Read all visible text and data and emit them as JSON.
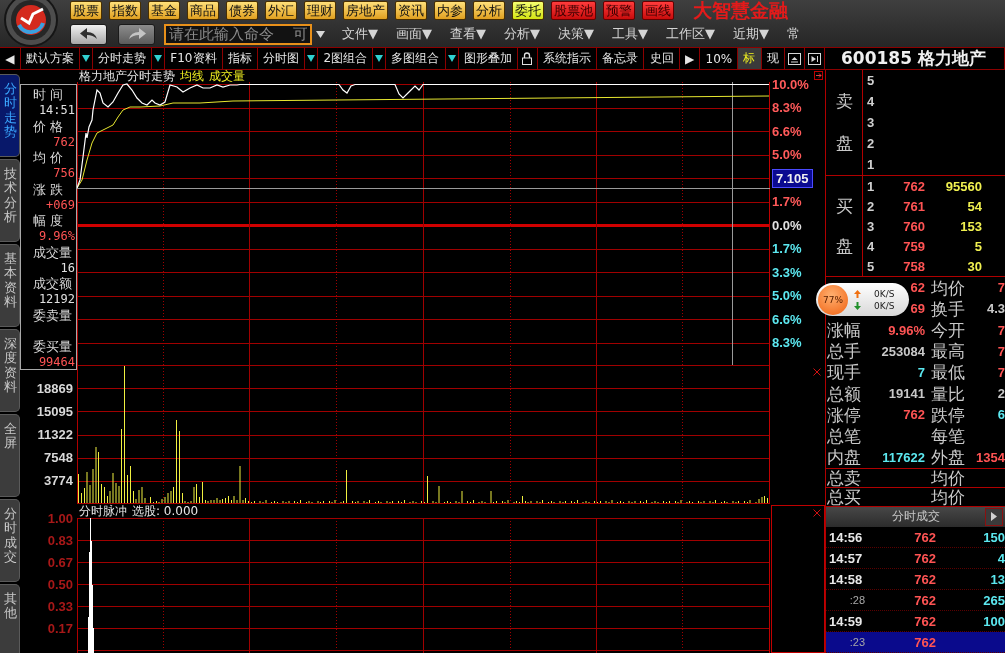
{
  "header": {
    "nav_buttons": [
      {
        "label": "股票",
        "kind": "market"
      },
      {
        "label": "指数",
        "kind": "market"
      },
      {
        "label": "基金",
        "kind": "market"
      },
      {
        "label": "商品",
        "kind": "market"
      },
      {
        "label": "债券",
        "kind": "market"
      },
      {
        "label": "外汇",
        "kind": "market"
      },
      {
        "label": "理财",
        "kind": "market"
      },
      {
        "label": "房地产",
        "kind": "market"
      },
      {
        "label": "资讯",
        "kind": "market"
      },
      {
        "label": "内参",
        "kind": "market"
      },
      {
        "label": "分析",
        "kind": "market"
      },
      {
        "label": "委托",
        "kind": "trade"
      },
      {
        "label": "股票池",
        "kind": "alert"
      },
      {
        "label": "预警",
        "kind": "alert"
      },
      {
        "label": "画线",
        "kind": "alert"
      }
    ],
    "title": "大智慧金融",
    "history": {
      "back_disabled": false,
      "forward_disabled": true
    },
    "command": {
      "placeholder": "请在此输入命令    可"
    },
    "menus": [
      "文件▼",
      "画面▼",
      "查看▼",
      "分析▼",
      "决策▼",
      "工具▼",
      "工作区▼",
      "近期▼",
      "常"
    ]
  },
  "toolbar": {
    "left_items": [
      {
        "label": "◀",
        "dropdown": false,
        "selected": false
      },
      {
        "label": "默认方案",
        "dropdown": true,
        "selected": false
      },
      {
        "label": "分时走势",
        "dropdown": true,
        "selected": false
      },
      {
        "label": "F10资料",
        "dropdown": false,
        "selected": false
      },
      {
        "label": "指标",
        "dropdown": false,
        "selected": false
      },
      {
        "label": "分时图",
        "dropdown": true,
        "selected": false
      },
      {
        "label": "2图组合",
        "dropdown": true,
        "selected": false
      },
      {
        "label": "多图组合",
        "dropdown": true,
        "selected": false
      },
      {
        "label": "图形叠加",
        "dropdown": false,
        "selected": false
      }
    ],
    "right_items": [
      {
        "label": "系统指示",
        "selected": false
      },
      {
        "label": "备忘录",
        "selected": false
      },
      {
        "label": "史回",
        "selected": false
      },
      {
        "label": "▶",
        "selected": false
      },
      {
        "label": "10%",
        "selected": false
      },
      {
        "label": "标",
        "selected": true
      },
      {
        "label": "现",
        "selected": false
      }
    ],
    "stock": "600185 格力地产"
  },
  "side_tabs": [
    {
      "label": "分时走势",
      "selected": true
    },
    {
      "label": "技术分析",
      "selected": false
    },
    {
      "label": "基本资料",
      "selected": false
    },
    {
      "label": "深度资料",
      "selected": false
    },
    {
      "label": "全屏",
      "selected": false
    },
    {
      "label": "分时成交",
      "selected": false
    },
    {
      "label": "其他",
      "selected": false
    }
  ],
  "price_chart": {
    "title": "格力地产分时走势",
    "legend": [
      "均线",
      "成交量"
    ],
    "info": [
      {
        "label": "时 间",
        "value": "14:51",
        "color": "#e0e0e0"
      },
      {
        "label": "价 格",
        "value": "762",
        "color": "#ff5454"
      },
      {
        "label": "均 价",
        "value": "756",
        "color": "#ff5454"
      },
      {
        "label": "涨 跌",
        "value": "+069",
        "color": "#ff5454"
      },
      {
        "label": "幅 度",
        "value": "9.96%",
        "color": "#ff5454"
      },
      {
        "label": "成交量",
        "value": "16",
        "color": "#e0e0e0"
      },
      {
        "label": "成交额",
        "value": "12192",
        "color": "#e0e0e0"
      },
      {
        "label": "委卖量"
      },
      {
        "label": "委买量",
        "value": "99464",
        "color": "#ff5454"
      }
    ],
    "right_axis": [
      {
        "label": "10.0%",
        "kind": "up"
      },
      {
        "label": "8.3%",
        "kind": "up"
      },
      {
        "label": "6.6%",
        "kind": "up"
      },
      {
        "label": "5.0%",
        "kind": "up"
      },
      {
        "label": "7.105",
        "kind": "cursor"
      },
      {
        "label": "1.7%",
        "kind": "up"
      },
      {
        "label": "0.0%",
        "kind": "zero"
      },
      {
        "label": "1.7%",
        "kind": "down"
      },
      {
        "label": "3.3%",
        "kind": "down"
      },
      {
        "label": "5.0%",
        "kind": "down"
      },
      {
        "label": "6.6%",
        "kind": "down"
      },
      {
        "label": "8.3%",
        "kind": "down"
      }
    ]
  },
  "volume_chart": {
    "axis": [
      "18869",
      "15095",
      "11322",
      "7548",
      "3774"
    ]
  },
  "indicator": {
    "title": "分时脉冲",
    "value": "选股: 0.000",
    "axis": [
      "1.00",
      "0.83",
      "0.67",
      "0.50",
      "0.33",
      "0.17"
    ]
  },
  "order_book": {
    "sell_label": [
      "卖",
      "盘"
    ],
    "sell": [
      {
        "rank": "5"
      },
      {
        "rank": "4"
      },
      {
        "rank": "3"
      },
      {
        "rank": "2"
      },
      {
        "rank": "1"
      }
    ],
    "buy_label": [
      "买",
      "盘"
    ],
    "buy": [
      {
        "rank": "1",
        "price": "762",
        "volume": "95560"
      },
      {
        "rank": "2",
        "price": "761",
        "volume": "54"
      },
      {
        "rank": "3",
        "price": "760",
        "volume": "153"
      },
      {
        "rank": "4",
        "price": "759",
        "volume": "5"
      },
      {
        "rank": "5",
        "price": "758",
        "volume": "30"
      }
    ]
  },
  "quote": {
    "rows": [
      {
        "cells": [
          {
            "value": "62",
            "color": "#ff5454"
          },
          {
            "label": "均价",
            "value": "7",
            "color": "#ff5454"
          }
        ]
      },
      {
        "cells": [
          {
            "value": "69",
            "color": "#ff5454"
          },
          {
            "label": "换手",
            "value": "4.3",
            "color": "#c8c8c8"
          }
        ]
      },
      {
        "cells": [
          {
            "label": "涨幅",
            "value": "9.96%",
            "color": "#ff5454"
          },
          {
            "label": "今开",
            "value": "7",
            "color": "#ff5454"
          }
        ]
      },
      {
        "cells": [
          {
            "label": "总手",
            "value": "253084",
            "color": "#c8c8c8"
          },
          {
            "label": "最高",
            "value": "7",
            "color": "#ff5454"
          }
        ]
      },
      {
        "cells": [
          {
            "label": "现手",
            "value": "7",
            "color": "#5ce8f0"
          },
          {
            "label": "最低",
            "value": "7",
            "color": "#ff5454"
          }
        ]
      },
      {
        "cells": [
          {
            "label": "总额",
            "value": "19141",
            "color": "#c8c8c8"
          },
          {
            "label": "量比",
            "value": "2",
            "color": "#c8c8c8"
          }
        ]
      },
      {
        "cells": [
          {
            "label": "涨停",
            "value": "762",
            "color": "#ff5454"
          },
          {
            "label": "跌停",
            "value": "6",
            "color": "#5ce8f0"
          }
        ]
      },
      {
        "cells": [
          {
            "label": "总笔"
          },
          {
            "label": "每笔"
          }
        ]
      },
      {
        "cells": [
          {
            "label": "内盘",
            "value": "117622",
            "color": "#5ce8f0"
          },
          {
            "label": "外盘",
            "value": "1354",
            "color": "#ff5454"
          }
        ]
      }
    ],
    "totals": [
      {
        "cells": [
          {
            "label": "总卖"
          },
          {
            "label": "均价"
          }
        ]
      },
      {
        "cells": [
          {
            "label": "总买"
          },
          {
            "label": "均价"
          }
        ]
      }
    ]
  },
  "trades": {
    "title": "分时成交",
    "rows": [
      {
        "time": "14:56",
        "kind": "minute",
        "price": "762",
        "volume": "150",
        "selected": false
      },
      {
        "time": "14:57",
        "kind": "minute",
        "price": "762",
        "volume": "4",
        "selected": false
      },
      {
        "time": "14:58",
        "kind": "minute",
        "price": "762",
        "volume": "13",
        "selected": false
      },
      {
        "time": ":28",
        "kind": "second",
        "price": "762",
        "volume": "265",
        "selected": false
      },
      {
        "time": "14:59",
        "kind": "minute",
        "price": "762",
        "volume": "100",
        "selected": false
      },
      {
        "time": ":23",
        "kind": "second",
        "price": "762",
        "selected": true
      }
    ]
  },
  "speed_widget": {
    "percent": "77%",
    "up": "0K/S",
    "down": "0K/S"
  }
}
